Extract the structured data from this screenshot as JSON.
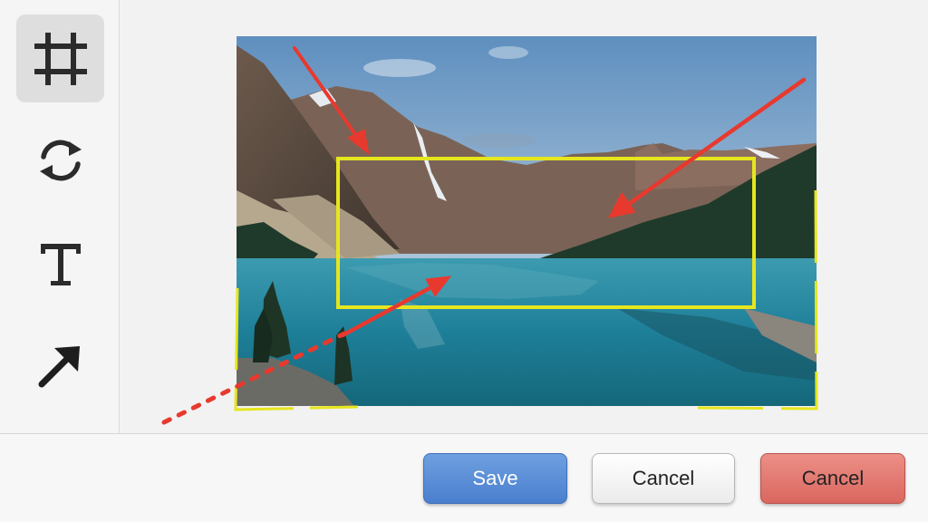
{
  "toolbar": {
    "tools": [
      {
        "name": "crop",
        "icon": "crop-icon",
        "active": true
      },
      {
        "name": "rotate",
        "icon": "rotate-icon",
        "active": false
      },
      {
        "name": "text",
        "icon": "text-icon",
        "active": false
      },
      {
        "name": "arrow",
        "icon": "arrow-icon",
        "active": false
      }
    ]
  },
  "canvas": {
    "image": "mountain-lake-photo",
    "annotations": {
      "highlight_color": "#e6e61e",
      "arrow_color": "#e8392e"
    }
  },
  "actions": {
    "save_label": "Save",
    "cancel_label": "Cancel",
    "cancel_red_label": "Cancel"
  }
}
